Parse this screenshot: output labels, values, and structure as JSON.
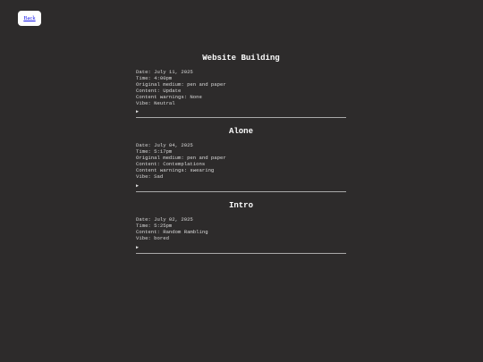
{
  "nav": {
    "back_label": "Back"
  },
  "entries": [
    {
      "title": "Website Building",
      "lines": [
        "Date: July 11, 2025",
        "Time: 4:00pm",
        "Original medium: pen and paper",
        "Content: Update",
        "Content warnings: None",
        "Vibe: Neutral"
      ],
      "toggle": "▶"
    },
    {
      "title": "Alone",
      "lines": [
        "Date: July 04, 2025",
        "Time: 5:17pm",
        "Original medium: pen and paper",
        "Content: Contemplations",
        "Content warnings: swearing",
        "Vibe: Sad"
      ],
      "toggle": "▶"
    },
    {
      "title": "Intro",
      "lines": [
        "Date: July 02, 2025",
        "Time: 5:25pm",
        "Content: Random Rambling",
        "Vibe: bored"
      ],
      "toggle": "▶"
    }
  ],
  "colors": {
    "background": "#2d2b2b",
    "title": "#ffffff",
    "text": "#d8d8d8",
    "divider": "#a9a9a9",
    "link": "#1a1aee"
  }
}
